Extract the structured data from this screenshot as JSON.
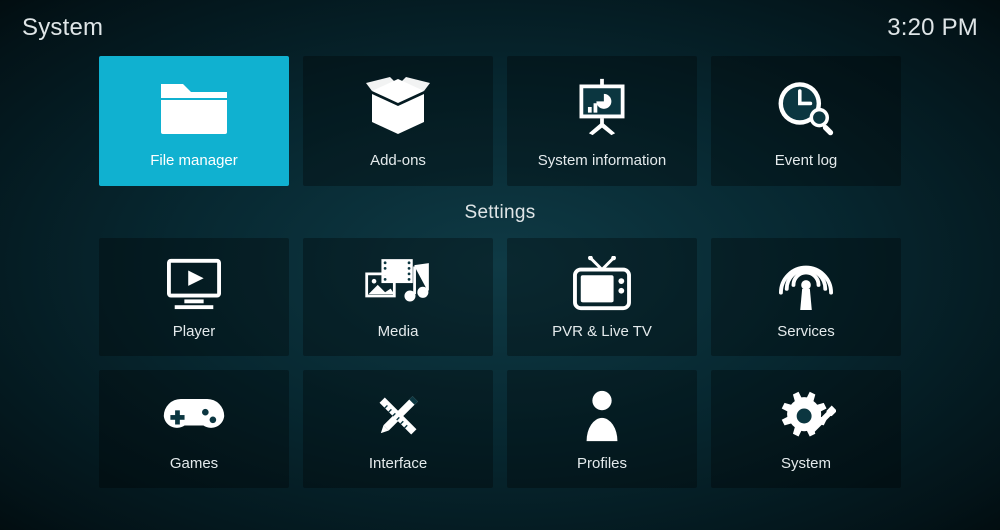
{
  "header": {
    "title": "System",
    "clock": "3:20 PM"
  },
  "section_top": [
    {
      "label": "File manager",
      "icon": "folder-icon",
      "selected": true
    },
    {
      "label": "Add-ons",
      "icon": "open-box-icon",
      "selected": false
    },
    {
      "label": "System information",
      "icon": "presentation-chart-icon",
      "selected": false
    },
    {
      "label": "Event log",
      "icon": "clock-search-icon",
      "selected": false
    }
  ],
  "section_title": "Settings",
  "settings_row1": [
    {
      "label": "Player",
      "icon": "player-icon"
    },
    {
      "label": "Media",
      "icon": "media-icon"
    },
    {
      "label": "PVR & Live TV",
      "icon": "tv-icon"
    },
    {
      "label": "Services",
      "icon": "broadcast-icon"
    }
  ],
  "settings_row2": [
    {
      "label": "Games",
      "icon": "gamepad-icon"
    },
    {
      "label": "Interface",
      "icon": "pencil-ruler-icon"
    },
    {
      "label": "Profiles",
      "icon": "person-icon"
    },
    {
      "label": "System",
      "icon": "gear-screwdriver-icon"
    }
  ]
}
